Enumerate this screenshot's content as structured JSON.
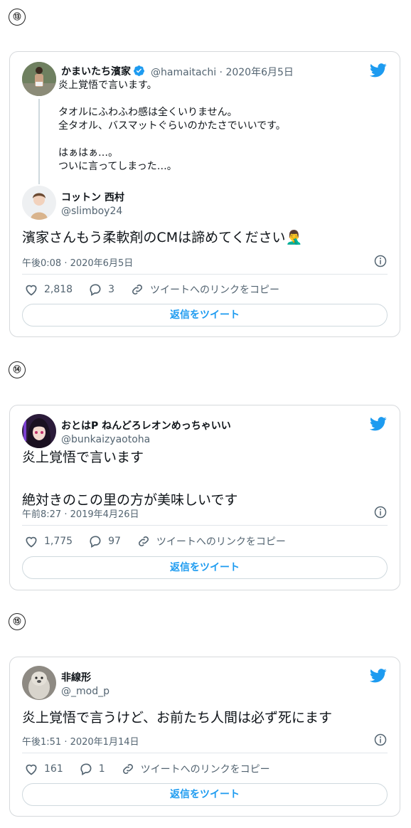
{
  "tweets": [
    {
      "number": "⑬",
      "quoted": {
        "name": "かまいたち濱家",
        "handle": "@hamaitachi",
        "date": "· 2020年6月5日",
        "lines": [
          "炎上覚悟で言います。",
          "",
          "タオルにふわふわ感は全くいりません。",
          "全タオル、バスマットぐらいのかたさでいいです。",
          "",
          "はぁはぁ…。",
          "ついに言ってしまった…。"
        ]
      },
      "name": "コットン 西村",
      "handle": "@slimboy24",
      "text": "濱家さんもう柔軟剤のCMは諦めてください🤦‍♂️",
      "timestamp": "午後0:08 · 2020年6月5日",
      "likes": "2,818",
      "replies": "3",
      "copy_link": "ツイートへのリンクをコピー",
      "reply_button": "返信をツイート"
    },
    {
      "number": "⑭",
      "name": "おとはP ねんどろレオンめっちゃいい",
      "handle": "@bunkaizyaotoha",
      "lines": [
        "炎上覚悟で言います",
        "",
        "絶対きのこの里の方が美味しいです"
      ],
      "timestamp": "午前8:27 · 2019年4月26日",
      "likes": "1,775",
      "replies": "97",
      "copy_link": "ツイートへのリンクをコピー",
      "reply_button": "返信をツイート"
    },
    {
      "number": "⑮",
      "name": "非線形",
      "handle": "@_mod_p",
      "text": "炎上覚悟で言うけど、お前たち人間は必ず死にます",
      "timestamp": "午後1:51 · 2020年1月14日",
      "likes": "161",
      "replies": "1",
      "copy_link": "ツイートへのリンクをコピー",
      "reply_button": "返信をツイート"
    }
  ],
  "colors": {
    "twitter_blue": "#1d9bf0",
    "text": "#0f1419",
    "muted": "#536471",
    "border": "#d6d9dc"
  },
  "icons": [
    "twitter-bird-icon",
    "verified-badge-icon",
    "info-icon",
    "heart-icon",
    "reply-icon",
    "link-icon"
  ]
}
